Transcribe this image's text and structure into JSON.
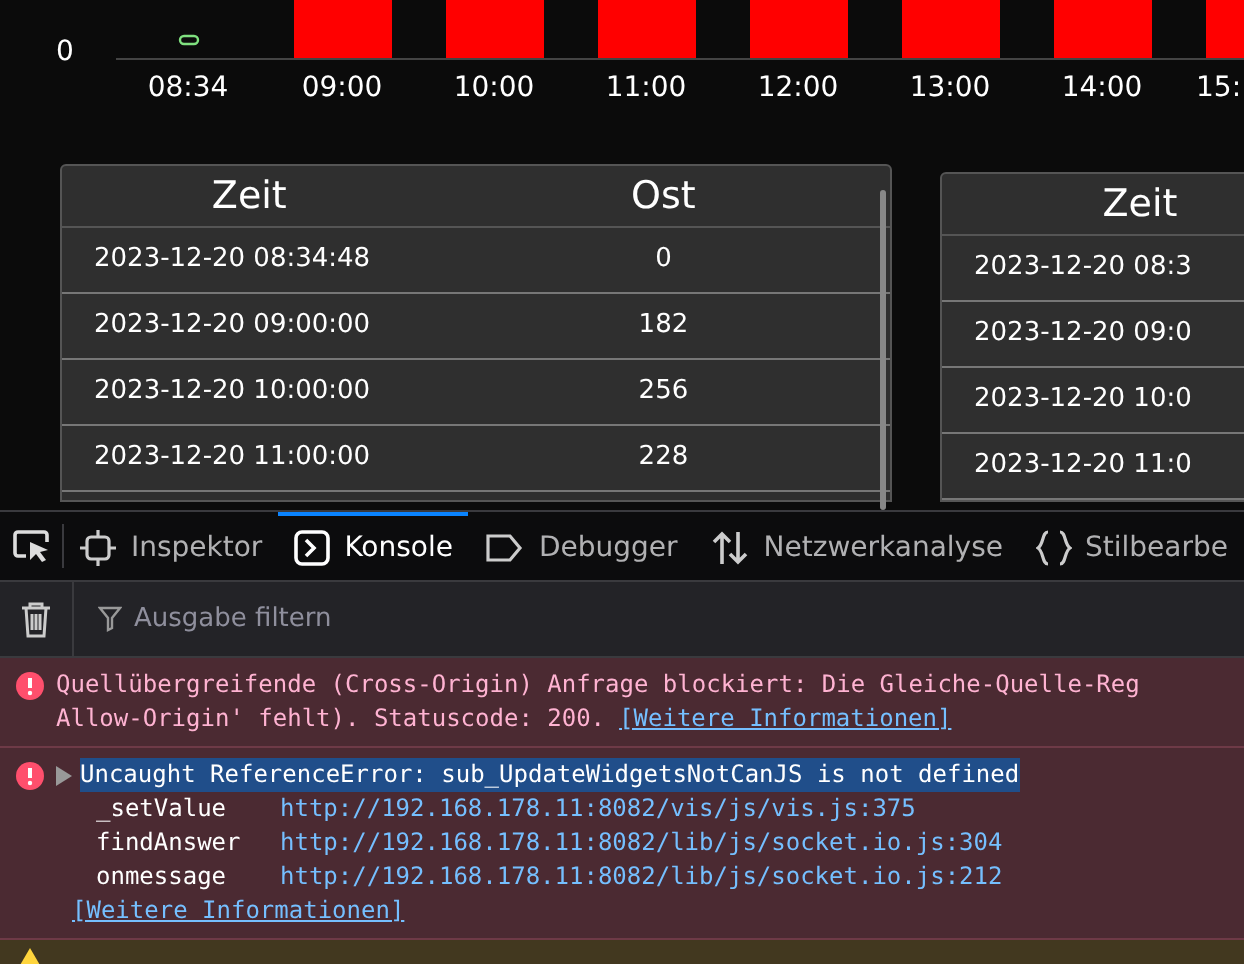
{
  "chart": {
    "y_label": "0",
    "x_labels": [
      "08:34",
      "09:00",
      "10:00",
      "11:00",
      "12:00",
      "13:00",
      "14:00",
      "15:"
    ]
  },
  "tables": [
    {
      "columns": [
        "Zeit",
        "Ost"
      ],
      "rows": [
        [
          "2023-12-20 08:34:48",
          "0"
        ],
        [
          "2023-12-20 09:00:00",
          "182"
        ],
        [
          "2023-12-20 10:00:00",
          "256"
        ],
        [
          "2023-12-20 11:00:00",
          "228"
        ]
      ]
    },
    {
      "columns": [
        "Zeit"
      ],
      "rows": [
        [
          "2023-12-20 08:3"
        ],
        [
          "2023-12-20 09:0"
        ],
        [
          "2023-12-20 10:0"
        ],
        [
          "2023-12-20 11:0"
        ]
      ]
    }
  ],
  "devtools": {
    "tabs": [
      {
        "label": "Inspektor",
        "selected": false
      },
      {
        "label": "Konsole",
        "selected": true
      },
      {
        "label": "Debugger",
        "selected": false
      },
      {
        "label": "Netzwerkanalyse",
        "selected": false
      },
      {
        "label": "Stilbearbe",
        "selected": false
      }
    ],
    "filter": {
      "placeholder": "Ausgabe filtern"
    },
    "messages": [
      {
        "kind": "error",
        "lines": [
          "Quellübergreifende (Cross-Origin) Anfrage blockiert: Die Gleiche-Quelle-Reg",
          "Allow-Origin' fehlt). Statuscode: 200."
        ],
        "link": "[Weitere Informationen]"
      },
      {
        "kind": "error",
        "expandable": true,
        "selected": true,
        "text": "Uncaught ReferenceError: sub_UpdateWidgetsNotCanJS is not defined",
        "stack": [
          {
            "fn": "_setValue",
            "url": "http://192.168.178.11:8082/vis/js/vis.js",
            "line": ":375"
          },
          {
            "fn": "findAnswer",
            "url": "http://192.168.178.11:8082/lib/js/socket.io.js",
            "line": ":304"
          },
          {
            "fn": "onmessage",
            "url": "http://192.168.178.11:8082/lib/js/socket.io.js",
            "line": ":212"
          }
        ],
        "link": "[Weitere Informationen]"
      },
      {
        "kind": "warning"
      }
    ]
  }
}
